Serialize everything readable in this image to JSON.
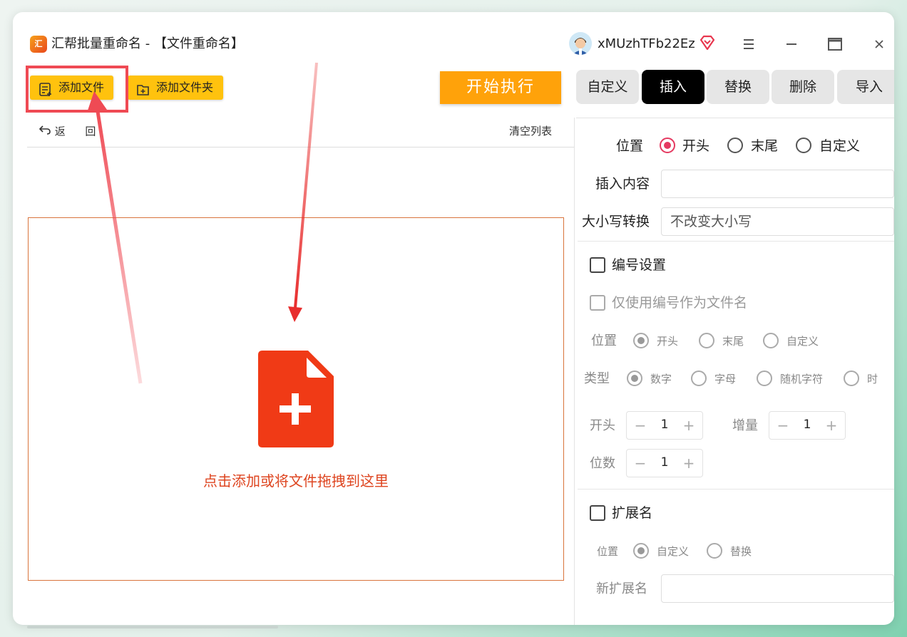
{
  "app": {
    "title": "汇帮批量重命名 - 【文件重命名】",
    "logo_text": "汇",
    "username": "xMUzhTFb22Ez"
  },
  "window_controls": [
    "menu-icon",
    "minimize-icon",
    "maximize-icon",
    "close-icon"
  ],
  "toolbar": {
    "add_file": "添加文件",
    "add_folder": "添加文件夹",
    "start": "开始执行",
    "undo": "返",
    "redo": "回",
    "clear_list": "清空列表"
  },
  "dropzone": {
    "text": "点击添加或将文件拖拽到这里"
  },
  "tabs": [
    {
      "label": "自定义",
      "active": false
    },
    {
      "label": "插入",
      "active": true
    },
    {
      "label": "替换",
      "active": false
    },
    {
      "label": "删除",
      "active": false
    },
    {
      "label": "导入",
      "active": false
    }
  ],
  "insert": {
    "position_label": "位置",
    "position_options": [
      "开头",
      "末尾",
      "自定义"
    ],
    "position_selected": "开头",
    "content_label": "插入内容",
    "content_value": "",
    "case_label": "大小写转换",
    "case_value": "不改变大小写"
  },
  "numbering": {
    "title": "编号设置",
    "only_number": "仅使用编号作为文件名",
    "position_label": "位置",
    "position_options": [
      "开头",
      "末尾",
      "自定义"
    ],
    "type_label": "类型",
    "type_options": [
      "数字",
      "字母",
      "随机字符",
      "时"
    ],
    "start_label": "开头",
    "start_value": "1",
    "step_label": "增量",
    "step_value": "1",
    "digits_label": "位数",
    "digits_value": "1"
  },
  "extension": {
    "title": "扩展名",
    "position_label": "位置",
    "options": [
      "自定义",
      "替换"
    ],
    "new_ext_label": "新扩展名",
    "new_ext_value": ""
  },
  "colors": {
    "accent_yellow": "#ffc20e",
    "start_orange": "#ffa20a",
    "drop_red": "#de4520",
    "annotation_red": "#ef4a54",
    "radio_pink": "#e53960"
  }
}
